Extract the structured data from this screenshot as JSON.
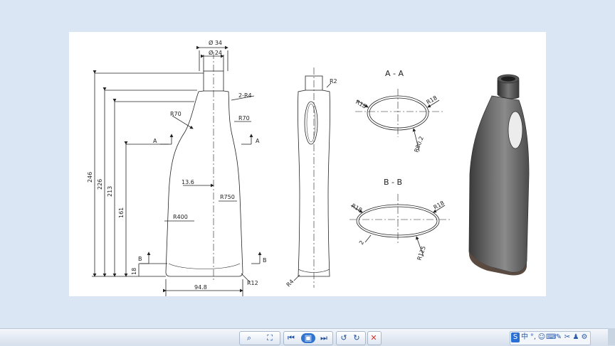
{
  "drawing": {
    "dimensions": {
      "dia_outer": "Ø 34",
      "dia_inner": "Ø 24",
      "h_total": "246",
      "h_226": "226",
      "h_213": "213",
      "h_161": "161",
      "h_18": "18",
      "width": "94.8",
      "offset": "13.6",
      "r_side_large": "R750",
      "r_side_lower": "R400",
      "r_shoulder_left": "R70",
      "r_shoulder_right": "R70",
      "r_neck": "2-R4",
      "r_base_corner": "R12",
      "r_side_top": "R2",
      "r_side_base": "R4"
    },
    "section_marks": {
      "a_left": "A",
      "a_right": "A",
      "b_left": "B",
      "b_right": "B"
    },
    "section_aa": {
      "title": "A - A",
      "r_left": "R18",
      "r_right": "R18",
      "r_bottom": "R80.2"
    },
    "section_bb": {
      "title": "B - B",
      "r_left": "R18",
      "r_right": "R18",
      "r_bottom": "R125",
      "wall": "2"
    }
  },
  "taskbar": {
    "buttons": [
      {
        "name": "zoom",
        "glyph": "⌕"
      },
      {
        "name": "fit",
        "glyph": "⛶"
      },
      {
        "name": "previous",
        "glyph": "⏮"
      },
      {
        "name": "slideshow",
        "glyph": "▣"
      },
      {
        "name": "next",
        "glyph": "⏭"
      },
      {
        "name": "rotate-left",
        "glyph": "↺"
      },
      {
        "name": "rotate-right",
        "glyph": "↻"
      },
      {
        "name": "delete",
        "glyph": "✕"
      }
    ],
    "tray_icons": [
      {
        "name": "ime",
        "glyph": "S"
      },
      {
        "name": "chinese",
        "glyph": "中"
      },
      {
        "name": "punct",
        "glyph": "°,"
      },
      {
        "name": "emoji",
        "glyph": "☺"
      },
      {
        "name": "keyboard",
        "glyph": "⌨"
      },
      {
        "name": "skin",
        "glyph": "✎"
      },
      {
        "name": "tools",
        "glyph": "✂"
      },
      {
        "name": "shirt",
        "glyph": "♟"
      },
      {
        "name": "grid",
        "glyph": "⚙"
      }
    ],
    "colors": {
      "delete": "#d0342c",
      "icon": "#1f4f9a"
    }
  }
}
